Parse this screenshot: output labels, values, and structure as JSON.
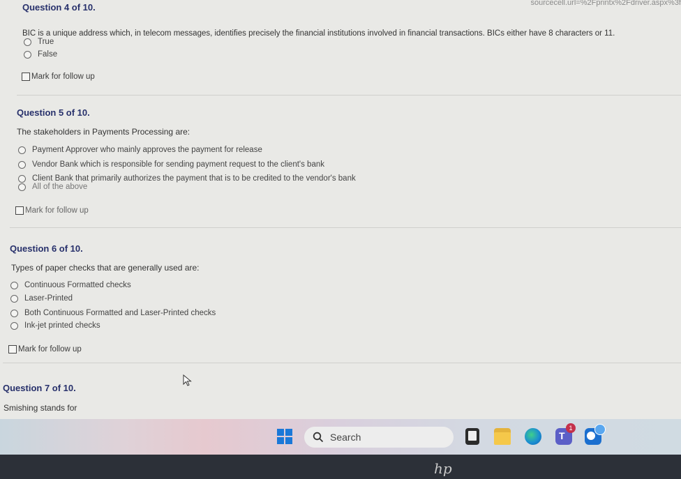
{
  "browser": {
    "url_fragment": "sourcecell.url=%2Fprintx%2Fdriver.aspx%3f"
  },
  "questions": [
    {
      "title": "Question 4 of 10.",
      "text": "BIC is a unique address which, in telecom messages, identifies precisely the financial institutions involved in financial transactions. BICs either have 8 characters or 11.",
      "options": [
        "True",
        "False"
      ],
      "follow_label": "Mark for follow up"
    },
    {
      "title": "Question 5 of 10.",
      "text": "The stakeholders in Payments Processing are:",
      "options": [
        "Payment Approver who mainly approves the payment for release",
        "Vendor Bank which is responsible for sending payment request to the client's bank",
        "Client Bank that primarily authorizes the payment that is to be credited to the vendor's bank",
        "All of the above"
      ],
      "follow_label": "Mark for follow up"
    },
    {
      "title": "Question 6 of 10.",
      "text": "Types of paper checks that are generally used are:",
      "options": [
        "Continuous Formatted checks",
        "Laser-Printed",
        "Both Continuous Formatted and Laser-Printed checks",
        "Ink-jet printed checks"
      ],
      "follow_label": "Mark for follow up"
    },
    {
      "title": "Question 7 of 10.",
      "text": "Smishing stands for"
    }
  ],
  "taskbar": {
    "search_label": "Search",
    "icons": [
      "windows-start-icon",
      "file-explorer-icon",
      "folder-icon",
      "edge-icon",
      "teams-icon",
      "outlook-icon"
    ],
    "teams_badge": "1"
  },
  "device": {
    "logo": "hp"
  }
}
